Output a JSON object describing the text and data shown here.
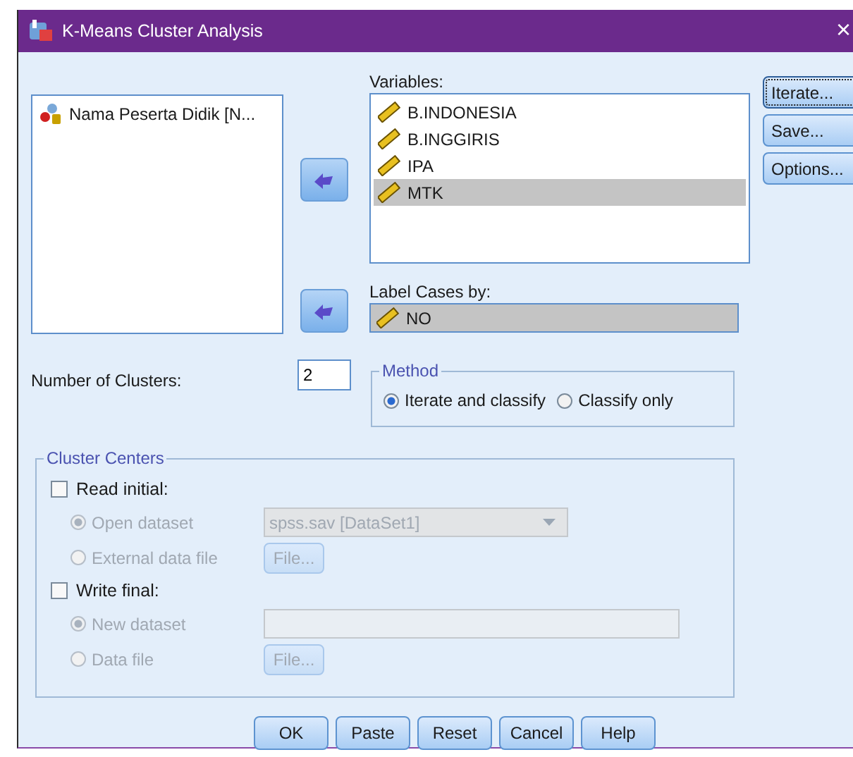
{
  "window": {
    "title": "K-Means Cluster Analysis",
    "close": "×"
  },
  "source_list": {
    "items": [
      {
        "label": "Nama Peserta Didik [N...",
        "kind": "nominal",
        "selected": false
      }
    ]
  },
  "variables": {
    "label": "Variables:",
    "items": [
      {
        "label": "B.INDONESIA",
        "kind": "scale",
        "selected": false
      },
      {
        "label": "B.INGGIRIS",
        "kind": "scale",
        "selected": false
      },
      {
        "label": "IPA",
        "kind": "scale",
        "selected": false
      },
      {
        "label": "MTK",
        "kind": "scale",
        "selected": true
      }
    ]
  },
  "label_cases": {
    "label": "Label Cases by:",
    "value": "NO",
    "kind": "scale"
  },
  "side_buttons": [
    {
      "label": "Iterate...",
      "focused": true
    },
    {
      "label": "Save...",
      "focused": false
    },
    {
      "label": "Options...",
      "focused": false
    }
  ],
  "number_of_clusters": {
    "label": "Number of Clusters:",
    "value": "2"
  },
  "method": {
    "title": "Method",
    "options": [
      {
        "label": "Iterate and classify",
        "selected": true
      },
      {
        "label": "Classify only",
        "selected": false
      }
    ]
  },
  "cluster_centers": {
    "title": "Cluster Centers",
    "read_initial": {
      "label": "Read initial:",
      "checked": false,
      "options": [
        {
          "label": "Open dataset",
          "selected": true
        },
        {
          "label": "External data file",
          "selected": false
        }
      ],
      "dataset": "spss.sav [DataSet1]",
      "file_button": "File..."
    },
    "write_final": {
      "label": "Write final:",
      "checked": false,
      "options": [
        {
          "label": "New dataset",
          "selected": true
        },
        {
          "label": "Data file",
          "selected": false
        }
      ],
      "file_button": "File..."
    }
  },
  "buttons": [
    "OK",
    "Paste",
    "Reset",
    "Cancel",
    "Help"
  ]
}
